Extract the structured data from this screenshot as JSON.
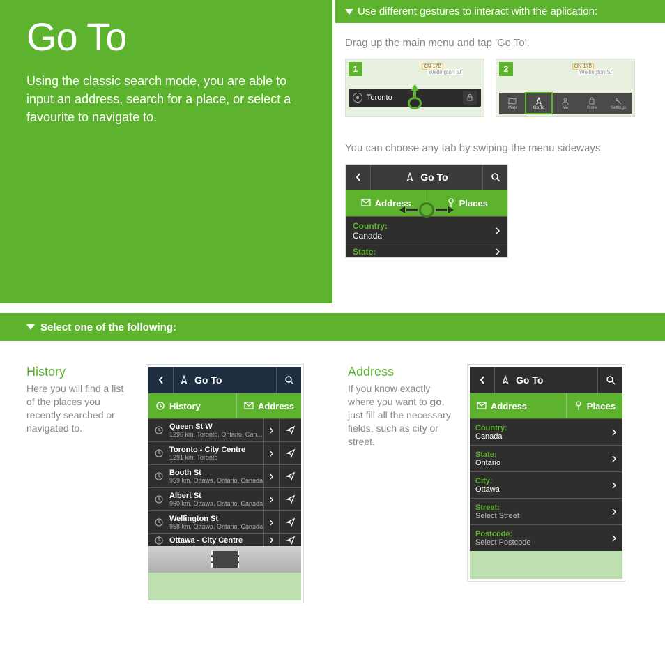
{
  "hero": {
    "title": "Go To",
    "description": "Using the classic search mode, you are able to input an address, search for a place, or select a favourite to navigate to."
  },
  "gesturesHeader": "Use different gestures to interact with the aplication:",
  "step1": {
    "caption": "Drag up the main menu and tap 'Go To'.",
    "thumb1Num": "1",
    "thumb1City": "Toronto",
    "thumbRoad": "Wellington St",
    "thumbTag": "ON-17B",
    "thumb2Num": "2",
    "thumb2Items": [
      {
        "label": "Map"
      },
      {
        "label": "Go To"
      },
      {
        "label": "Me"
      },
      {
        "label": "Store"
      },
      {
        "label": "Settings"
      }
    ]
  },
  "step2": {
    "caption": "You can choose any tab by swiping the menu sideways.",
    "title": "Go To",
    "tab1": "Address",
    "tab2": "Places",
    "countryLbl": "Country:",
    "countryVal": "Canada",
    "stateLbl": "State:"
  },
  "selectHeader": "Select one of the following:",
  "history": {
    "title": "History",
    "description": "Here you will find a list of the places you recently searched or navigated to.",
    "phoneTitle": "Go To",
    "tabHistory": "History",
    "tabAddress": "Address",
    "items": [
      {
        "name": "Queen St W",
        "sub": "1296 km, Toronto, Ontario, Canada"
      },
      {
        "name": "Toronto - City Centre",
        "sub": "1291 km, Toronto"
      },
      {
        "name": "Booth St",
        "sub": "959 km, Ottawa, Ontario, Canada"
      },
      {
        "name": "Albert St",
        "sub": "960 km, Ottawa, Ontario, Canada"
      },
      {
        "name": "Wellington St",
        "sub": "958 km, Ottawa, Ontario, Canada"
      },
      {
        "name": "Ottawa - City Centre",
        "sub": ""
      }
    ]
  },
  "address": {
    "title": "Address",
    "descriptionPrefix": "If you know exactly where you want to ",
    "descriptionBold": "go",
    "descriptionSuffix": ", just fill all the necessary fields, such as city or street.",
    "phoneTitle": "Go To",
    "tabAddress": "Address",
    "tabPlaces": "Places",
    "rows": [
      {
        "lbl": "Country:",
        "val": "Canada",
        "placeholder": false
      },
      {
        "lbl": "State:",
        "val": "Ontario",
        "placeholder": false
      },
      {
        "lbl": "City:",
        "val": "Ottawa",
        "placeholder": false
      },
      {
        "lbl": "Street:",
        "val": "Select Street",
        "placeholder": true
      },
      {
        "lbl": "Postcode:",
        "val": "Select Postcode",
        "placeholder": true
      }
    ]
  }
}
